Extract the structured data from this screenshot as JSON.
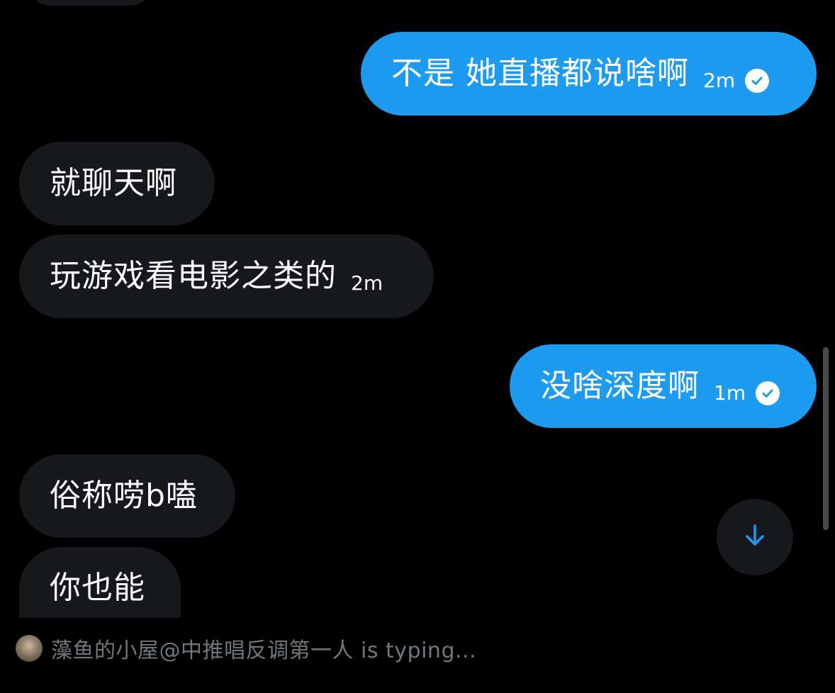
{
  "messages": [
    {
      "id": "m1",
      "direction": "outgoing",
      "text": "不是 她直播都说啥啊",
      "time": "2m",
      "read": true
    },
    {
      "id": "m2",
      "direction": "incoming",
      "text": "就聊天啊",
      "time": ""
    },
    {
      "id": "m3",
      "direction": "incoming",
      "text": "玩游戏看电影之类的",
      "time": "2m"
    },
    {
      "id": "m4",
      "direction": "outgoing",
      "text": "没啥深度啊",
      "time": "1m",
      "read": true
    },
    {
      "id": "m5",
      "direction": "incoming",
      "text": "俗称唠b嗑",
      "time": ""
    },
    {
      "id": "m6",
      "direction": "incoming",
      "text": "你也能",
      "time": ""
    }
  ],
  "typing_indicator": {
    "text": "藻鱼的小屋@中推唱反调第一人 is typing..."
  },
  "icons": {
    "read_receipt": "check-circle-icon",
    "scroll_down": "arrow-down-icon"
  },
  "colors": {
    "background": "#000000",
    "outgoing_bubble": "#1d9bf0",
    "incoming_bubble": "#16181c",
    "muted_text": "#71767b"
  }
}
